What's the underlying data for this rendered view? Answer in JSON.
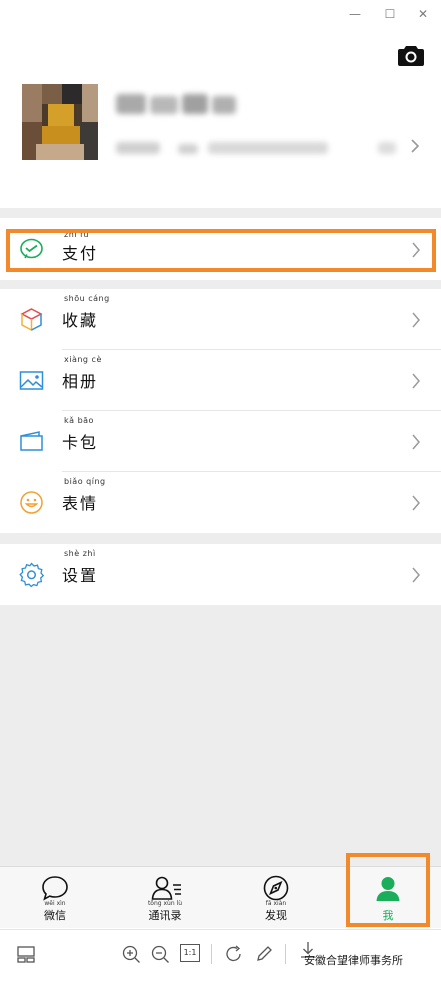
{
  "window": {
    "minimize_glyph": "—",
    "maximize_glyph": "☐",
    "close_glyph": "✕"
  },
  "profile": {
    "camera_icon": "camera-icon"
  },
  "menu": {
    "pay": {
      "label": "支付",
      "pinyin": "zhī fù",
      "icon": "wechat-pay-icon"
    },
    "favorites": {
      "label": "收藏",
      "pinyin": "shōu cáng",
      "icon": "cube-icon"
    },
    "album": {
      "label": "相册",
      "pinyin": "xiàng cè",
      "icon": "image-icon"
    },
    "cards": {
      "label": "卡包",
      "pinyin": "kǎ bāo",
      "icon": "card-icon"
    },
    "stickers": {
      "label": "表情",
      "pinyin": "biǎo qíng",
      "icon": "smile-icon"
    },
    "settings": {
      "label": "设置",
      "pinyin": "shè zhì",
      "icon": "gear-icon"
    }
  },
  "tabs": [
    {
      "label": "微信",
      "pinyin": "wēi xìn",
      "icon": "chat-bubble-icon"
    },
    {
      "label": "通讯录",
      "pinyin": "tōng xùn lù",
      "icon": "contacts-icon"
    },
    {
      "label": "发现",
      "pinyin": "fā xiàn",
      "icon": "compass-icon"
    },
    {
      "label": "我",
      "pinyin": "",
      "icon": "person-icon",
      "active": true
    }
  ],
  "viewer": {
    "fit_label": "1:1",
    "watermark": "安徽合望律师事务所"
  },
  "colors": {
    "accent_green": "#1aad5a",
    "highlight_orange": "#f28a2c",
    "background_gray": "#ededed"
  }
}
